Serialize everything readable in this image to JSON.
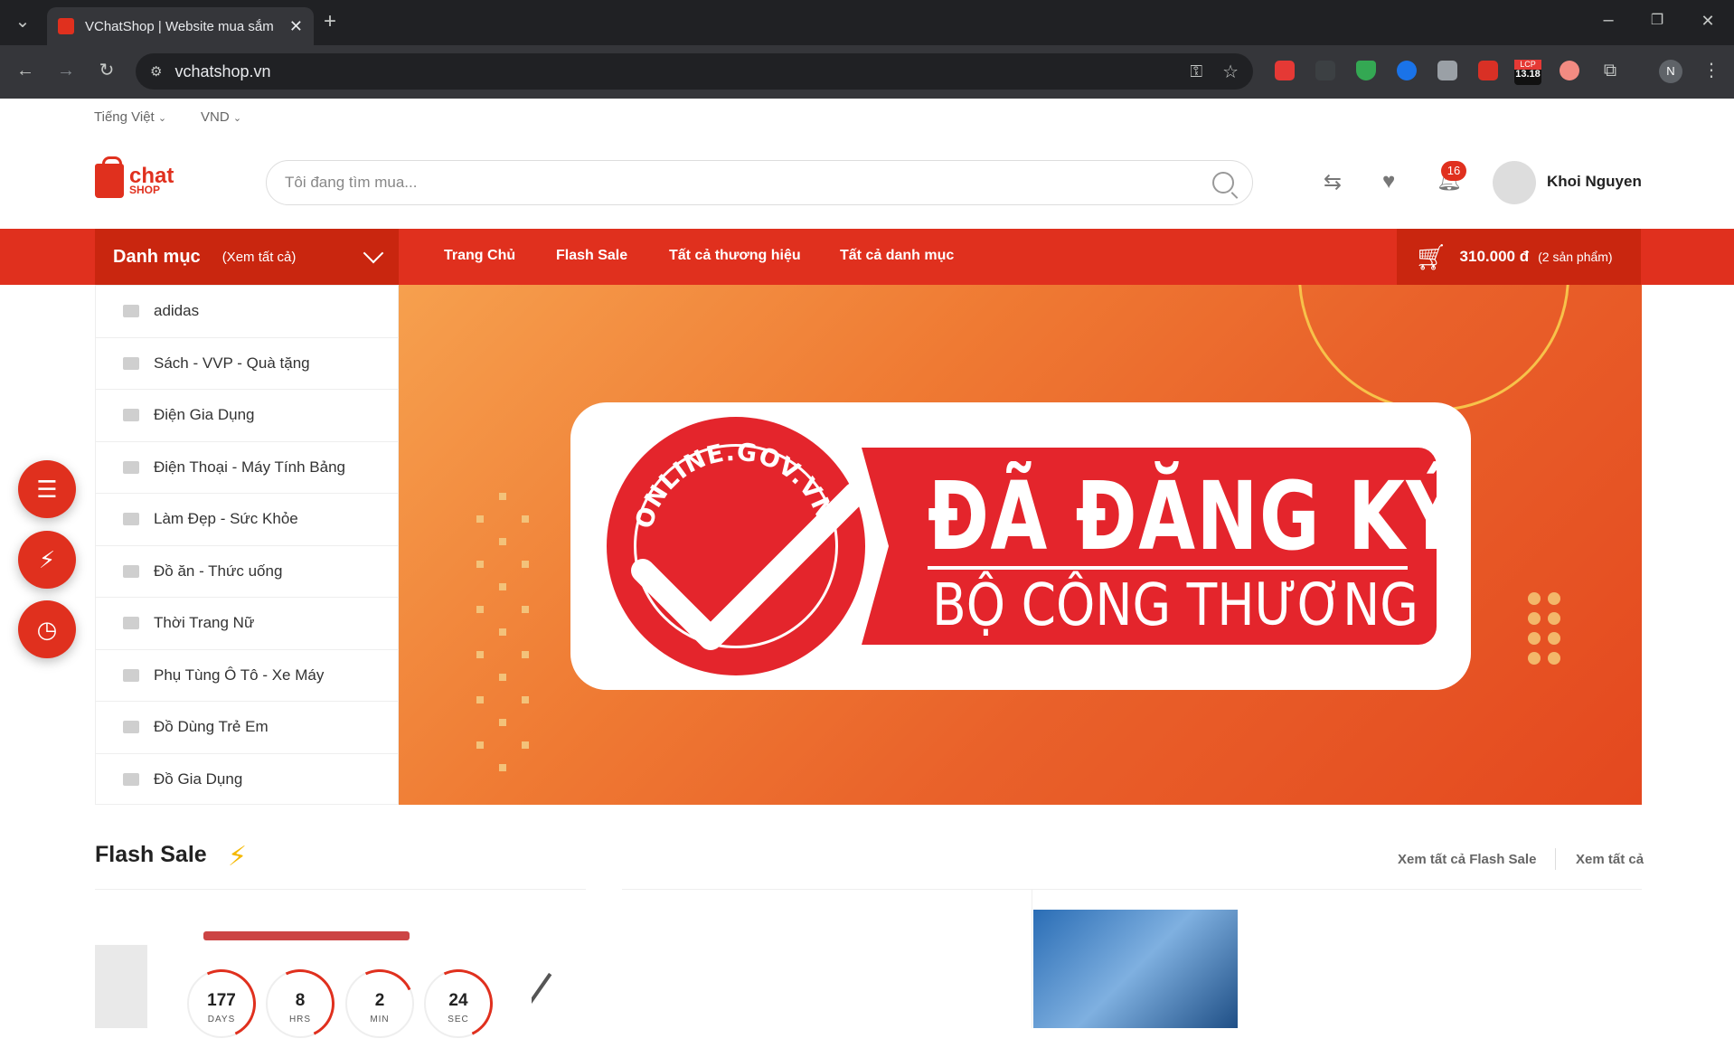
{
  "browser": {
    "tab_title": "VChatShop | Website mua sắm",
    "url": "vchatshop.vn",
    "lcp_badge_top": "LCP",
    "lcp_badge_value": "13.18",
    "profile_initial": "N"
  },
  "topbar": {
    "language": "Tiếng Việt",
    "currency": "VND"
  },
  "header": {
    "logo_text_1": "chat",
    "logo_text_2": "SHOP",
    "search_placeholder": "Tôi đang tìm mua...",
    "notification_count": "16",
    "user_name": "Khoi Nguyen"
  },
  "nav": {
    "category_title": "Danh mục",
    "category_view_all": "(Xem tất cả)",
    "links": [
      "Trang Chủ",
      "Flash Sale",
      "Tất cả thương hiệu",
      "Tất cả danh mục"
    ],
    "cart_amount": "310.000 đ",
    "cart_count": "(2 sản phẩm)"
  },
  "categories": [
    "adidas",
    "Sách - VVP - Quà tặng",
    "Điện Gia Dụng",
    "Điện Thoại - Máy Tính Bảng",
    "Làm Đẹp - Sức Khỏe",
    "Đồ ăn - Thức uống",
    "Thời Trang Nữ",
    "Phụ Tùng Ô Tô - Xe Máy",
    "Đồ Dùng Trẻ Em",
    "Đồ Gia Dụng"
  ],
  "banner": {
    "seal_text": "ONLINE.GOV.VN",
    "line1": "ĐÃ ĐĂNG KÝ",
    "line2": "BỘ CÔNG THƯƠNG"
  },
  "flash_sale": {
    "title": "Flash Sale",
    "view_all_flash": "Xem tất cả Flash Sale",
    "view_all": "Xem tất cả",
    "countdown": [
      {
        "value": "177",
        "label": "DAYS"
      },
      {
        "value": "8",
        "label": "HRS"
      },
      {
        "value": "2",
        "label": "MIN"
      },
      {
        "value": "24",
        "label": "SEC"
      }
    ]
  },
  "colors": {
    "brand": "#e0301e",
    "brand_dark": "#c9260f",
    "accent_yellow": "#f5b800"
  }
}
